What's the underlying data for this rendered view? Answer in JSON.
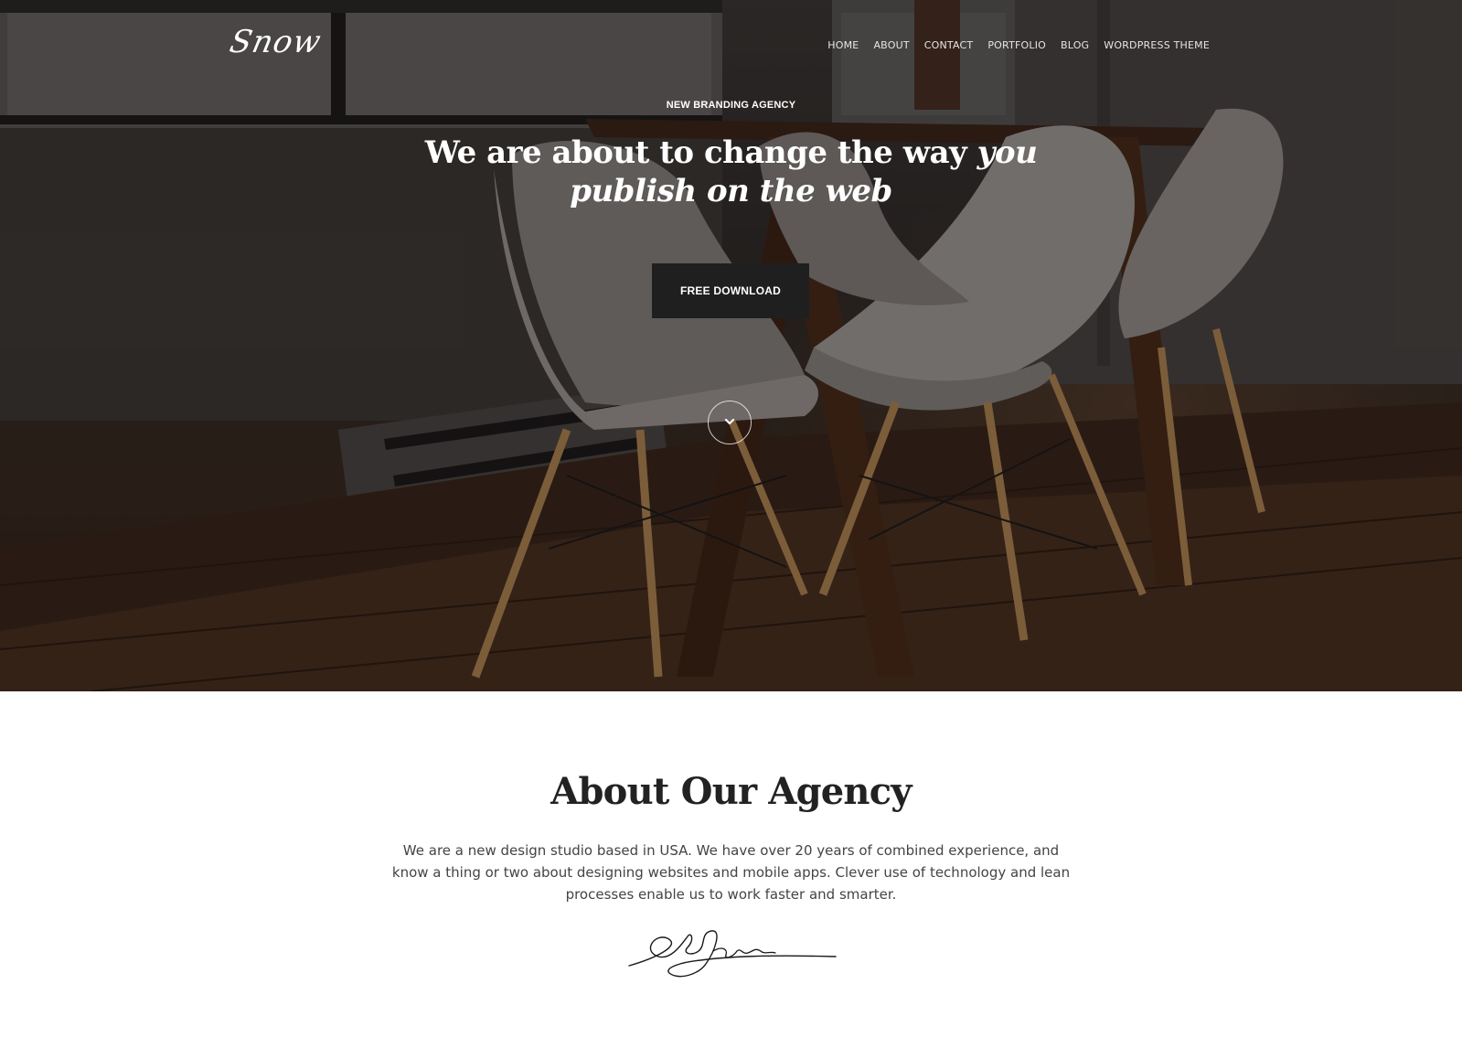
{
  "header": {
    "logo_text": "Snow",
    "nav": [
      {
        "label": "HOME"
      },
      {
        "label": "ABOUT"
      },
      {
        "label": "CONTACT"
      },
      {
        "label": "PORTFOLIO"
      },
      {
        "label": "BLOG"
      },
      {
        "label": "WORDPRESS THEME"
      }
    ]
  },
  "hero": {
    "eyebrow": "NEW BRANDING AGENCY",
    "headline_plain": "We are about to change the way",
    "headline_italic": "you publish on the web",
    "button_label": "FREE DOWNLOAD",
    "scroll_icon": "chevron-down-icon",
    "background_image": "dark office room with wooden table and white chairs"
  },
  "about": {
    "title": "About Our Agency",
    "body": "We are a new design studio based in USA. We have over 20 years of combined experience, and know a thing or two about designing websites and mobile apps. Clever use of technology and lean processes enable us to work faster and smarter.",
    "signature": "handwritten signature"
  },
  "colors": {
    "button_bg": "#1f1f1f",
    "heading_text": "#222222",
    "body_text": "#444444",
    "hero_text": "#ffffff"
  }
}
